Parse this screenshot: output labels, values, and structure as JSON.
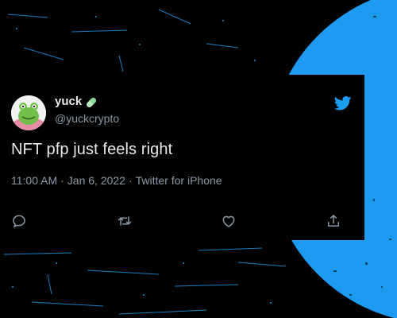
{
  "tweet": {
    "display_name": "yuck",
    "handle": "@yuckcrypto",
    "text": "NFT pfp just feels right",
    "time": "11:00 AM",
    "date": "Jan 6, 2022",
    "source": "Twitter for iPhone",
    "separator": "·"
  },
  "icons": {
    "verified_badge": "pill-icon",
    "brand": "twitter-bird-icon",
    "actions": [
      "reply-icon",
      "retweet-icon",
      "like-icon",
      "share-icon"
    ]
  },
  "colors": {
    "background": "#000000",
    "accent_blue": "#1d9bf0",
    "text_primary": "#e7e9ea",
    "text_secondary": "#8b98a5"
  }
}
